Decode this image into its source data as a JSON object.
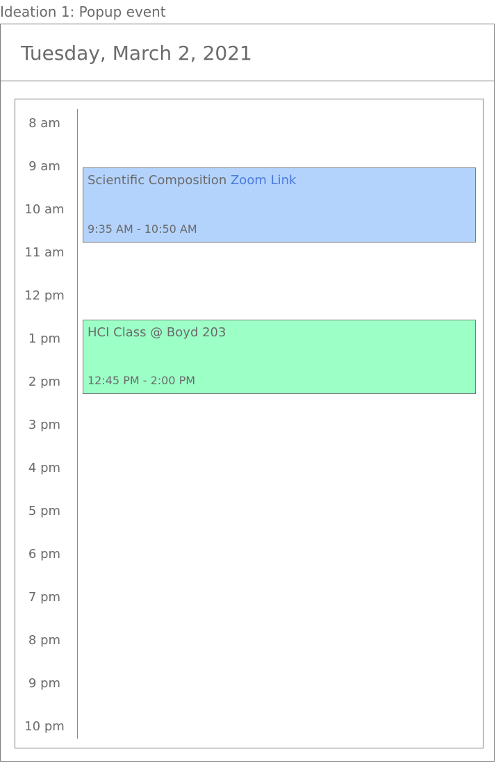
{
  "caption": "Ideation 1: Popup event",
  "header": {
    "date": "Tuesday, March 2, 2021"
  },
  "hours": [
    "8 am",
    "9 am",
    "10 am",
    "11 am",
    "12 pm",
    "1 pm",
    "2 pm",
    "3 pm",
    "4 pm",
    "5 pm",
    "6 pm",
    "7 pm",
    "8 pm",
    "9 pm",
    "10 pm"
  ],
  "events": [
    {
      "title": "Scientific Composition",
      "link": "Zoom Link",
      "time": "9:35 AM - 10:50 AM",
      "color": "#b3d3fd"
    },
    {
      "title": "HCI Class @ Boyd 203",
      "time": "12:45 PM - 2:00 PM",
      "color": "#9bffc6"
    }
  ],
  "colors": {
    "border": "#7a7a7a",
    "text": "#6b6b6b",
    "link": "#4a7bdc"
  }
}
